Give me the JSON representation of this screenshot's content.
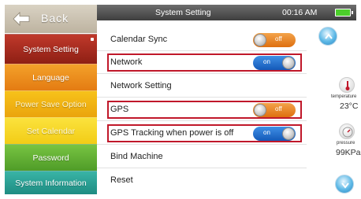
{
  "sidebar": {
    "back_label": "Back",
    "items": [
      {
        "label": "System Setting"
      },
      {
        "label": "Language"
      },
      {
        "label": "Power Save Option"
      },
      {
        "label": "Set Calendar"
      },
      {
        "label": "Password"
      },
      {
        "label": "System Information"
      }
    ]
  },
  "header": {
    "title": "System Setting",
    "time": "00:16 AM",
    "battery_icon": "battery-full-icon"
  },
  "settings": [
    {
      "label": "Calendar Sync",
      "toggle": "off",
      "highlighted": false
    },
    {
      "label": "Network",
      "toggle": "on",
      "highlighted": true
    },
    {
      "label": "Network Setting",
      "toggle": null,
      "highlighted": false
    },
    {
      "label": "GPS",
      "toggle": "off",
      "highlighted": true
    },
    {
      "label": "GPS Tracking when power is off",
      "toggle": "on",
      "highlighted": true
    },
    {
      "label": "Bind Machine",
      "toggle": null,
      "highlighted": false
    },
    {
      "label": "Reset",
      "toggle": null,
      "highlighted": false
    }
  ],
  "toggle_text": {
    "on": "on",
    "off": "off"
  },
  "right_panel": {
    "temperature_label": "temperature",
    "temperature_value": "23°C",
    "pressure_label": "pressure",
    "pressure_value": "99KPa"
  },
  "colors": {
    "highlight": "#c0182a",
    "toggle_on": "#1e6fd0",
    "toggle_off": "#e8831e",
    "battery": "#4ccf2b"
  }
}
